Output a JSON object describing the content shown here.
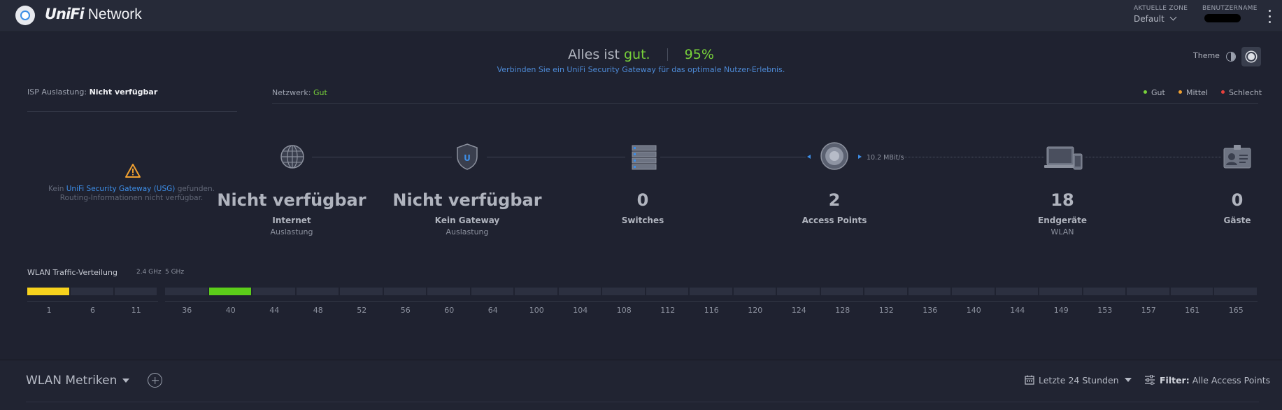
{
  "header": {
    "brand_uni": "UniFi",
    "brand_network": "Network",
    "zone_label": "AKTUELLE ZONE",
    "zone_value": "Default",
    "user_label": "BENUTZERNAME"
  },
  "status": {
    "prefix": "Alles ist",
    "word": "gut.",
    "percent": "95%",
    "subtitle": "Verbinden Sie ein UniFi Security Gateway für das optimale Nutzer-Erlebnis."
  },
  "theme": {
    "label": "Theme"
  },
  "isp": {
    "label": "ISP Auslastung:",
    "value": "Nicht verfügbar",
    "warning_prefix": "Kein",
    "warning_link": "UniFi Security Gateway (USG)",
    "warning_suffix": "gefunden. Routing-Informationen nicht verfügbar."
  },
  "network": {
    "label": "Netzwerk:",
    "value": "Gut",
    "legend": [
      {
        "label": "Gut",
        "color": "#78d23a"
      },
      {
        "label": "Mittel",
        "color": "#f0a030"
      },
      {
        "label": "Schlecht",
        "color": "#e8413c"
      }
    ],
    "rate": "10.2 MBit/s",
    "nodes": [
      {
        "icon": "globe-icon",
        "value": "Nicht verfügbar",
        "label": "Internet",
        "sub": "Auslastung"
      },
      {
        "icon": "shield-icon",
        "value": "Nicht verfügbar",
        "label": "Kein Gateway",
        "sub": "Auslastung"
      },
      {
        "icon": "switch-stack-icon",
        "value": "0",
        "label": "Switches",
        "sub": ""
      },
      {
        "icon": "access-point-icon",
        "value": "2",
        "label": "Access Points",
        "sub": ""
      },
      {
        "icon": "laptop-phone-icon",
        "value": "18",
        "label": "Endgeräte",
        "sub": "WLAN"
      },
      {
        "icon": "guest-badge-icon",
        "value": "0",
        "label": "Gäste",
        "sub": ""
      }
    ]
  },
  "wlan": {
    "title": "WLAN Traffic-Verteilung",
    "band_24": "2.4 GHz",
    "band_5": "5 GHz",
    "colors": {
      "active_24": "#f7d21d",
      "active_5": "#5ccd1a"
    },
    "channels_24": [
      {
        "label": "1",
        "active": true
      },
      {
        "label": "6",
        "active": false
      },
      {
        "label": "11",
        "active": false
      }
    ],
    "channels_5": [
      {
        "label": "36",
        "active": false
      },
      {
        "label": "40",
        "active": true
      },
      {
        "label": "44",
        "active": false
      },
      {
        "label": "48",
        "active": false
      },
      {
        "label": "52",
        "active": false
      },
      {
        "label": "56",
        "active": false
      },
      {
        "label": "60",
        "active": false
      },
      {
        "label": "64",
        "active": false
      },
      {
        "label": "100",
        "active": false
      },
      {
        "label": "104",
        "active": false
      },
      {
        "label": "108",
        "active": false
      },
      {
        "label": "112",
        "active": false
      },
      {
        "label": "116",
        "active": false
      },
      {
        "label": "120",
        "active": false
      },
      {
        "label": "124",
        "active": false
      },
      {
        "label": "128",
        "active": false
      },
      {
        "label": "132",
        "active": false
      },
      {
        "label": "136",
        "active": false
      },
      {
        "label": "140",
        "active": false
      },
      {
        "label": "144",
        "active": false
      },
      {
        "label": "149",
        "active": false
      },
      {
        "label": "153",
        "active": false
      },
      {
        "label": "157",
        "active": false
      },
      {
        "label": "161",
        "active": false
      },
      {
        "label": "165",
        "active": false
      }
    ]
  },
  "metrics": {
    "title": "WLAN Metriken",
    "range": "Letzte 24 Stunden",
    "filter_label": "Filter:",
    "filter_value": "Alle Access Points"
  }
}
